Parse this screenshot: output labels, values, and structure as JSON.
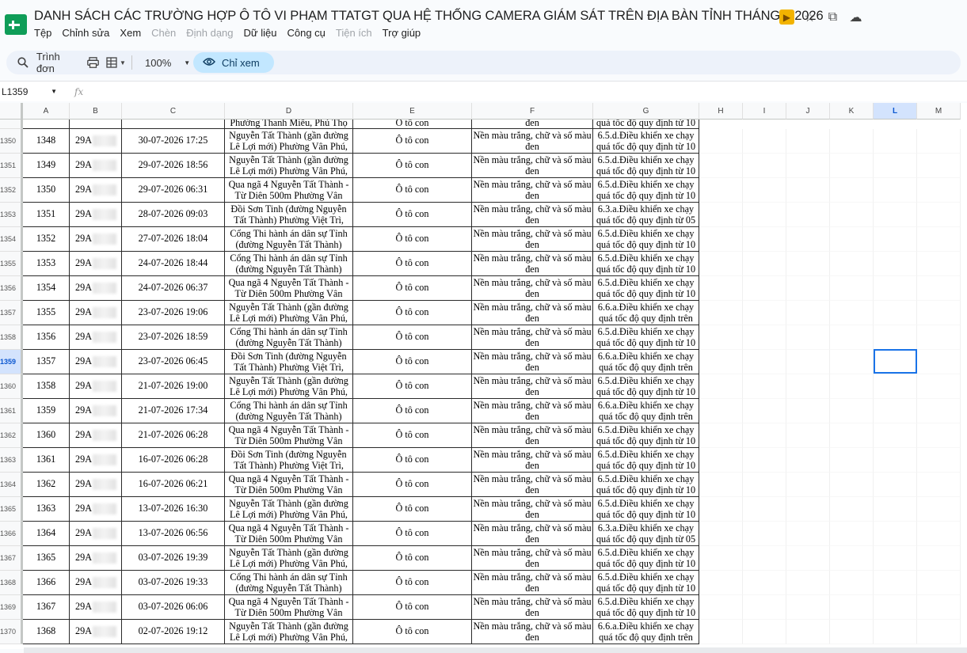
{
  "app": {
    "title": "DANH SÁCH CÁC TRƯỜNG HỢP Ô TÔ VI PHẠM TTATGT QUA HỆ THỐNG CAMERA GIÁM SÁT TRÊN ĐỊA BÀN TỈNH THÁNG 7.2026"
  },
  "menu": {
    "items": [
      {
        "label": "Tệp"
      },
      {
        "label": "Chỉnh sửa"
      },
      {
        "label": "Xem"
      },
      {
        "label": "Chèn"
      },
      {
        "label": "Định dạng"
      },
      {
        "label": "Dữ liệu"
      },
      {
        "label": "Công cụ"
      },
      {
        "label": "Tiện ích"
      },
      {
        "label": "Trợ giúp"
      }
    ]
  },
  "toolbar": {
    "search_label": "Trình đơn",
    "zoom": "100%",
    "view_only_label": "Chỉ xem"
  },
  "formula": {
    "name_box": "L1359",
    "fx": "fx"
  },
  "columns": [
    "A",
    "B",
    "C",
    "D",
    "E",
    "F",
    "G",
    "H",
    "I",
    "J",
    "K",
    "L",
    "M"
  ],
  "selected_column": "L",
  "selected_row": "1359",
  "rows": [
    {
      "n": "1350",
      "a": "1348",
      "b": "29A",
      "c": "30-07-2026 17:25",
      "d": "Nguyễn Tất Thành (gần đường Lê Lợi mới) Phường Vân Phú,",
      "e": "Ô tô con",
      "f": "Nền màu trắng, chữ và số màu đen",
      "g": "6.5.d.Điều khiển xe chạy quá tốc độ quy định từ 10"
    },
    {
      "n": "1351",
      "a": "1349",
      "b": "29A",
      "c": "29-07-2026 18:56",
      "d": "Nguyễn Tất Thành (gần đường Lê Lợi mới) Phường Vân Phú,",
      "e": "Ô tô con",
      "f": "Nền màu trắng, chữ và số màu đen",
      "g": "6.5.d.Điều khiển xe chạy quá tốc độ quy định từ 10"
    },
    {
      "n": "1352",
      "a": "1350",
      "b": "29A",
      "c": "29-07-2026 06:31",
      "d": "Qua ngã 4 Nguyễn Tất Thành - Từ Diên 500m Phường Vân",
      "e": "Ô tô con",
      "f": "Nền màu trắng, chữ và số màu đen",
      "g": "6.5.d.Điều khiển xe chạy quá tốc độ quy định từ 10"
    },
    {
      "n": "1353",
      "a": "1351",
      "b": "29A",
      "c": "28-07-2026 09:03",
      "d": "Đồi Sơn Tinh (đường Nguyễn Tất Thành) Phường Việt Trì,",
      "e": "Ô tô con",
      "f": "Nền màu trắng, chữ và số màu đen",
      "g": "6.3.a.Điều khiển xe chạy quá tốc độ quy định từ 05"
    },
    {
      "n": "1354",
      "a": "1352",
      "b": "29A",
      "c": "27-07-2026 18:04",
      "d": "Cổng Thi hành án dân sự Tỉnh (đường Nguyễn Tất Thành)",
      "e": "Ô tô con",
      "f": "Nền màu trắng, chữ và số màu đen",
      "g": "6.5.d.Điều khiển xe chạy quá tốc độ quy định từ 10"
    },
    {
      "n": "1355",
      "a": "1353",
      "b": "29A",
      "c": "24-07-2026 18:44",
      "d": "Cổng Thi hành án dân sự Tỉnh (đường Nguyễn Tất Thành)",
      "e": "Ô tô con",
      "f": "Nền màu trắng, chữ và số màu đen",
      "g": "6.5.d.Điều khiển xe chạy quá tốc độ quy định từ 10"
    },
    {
      "n": "1356",
      "a": "1354",
      "b": "29A",
      "c": "24-07-2026 06:37",
      "d": "Qua ngã 4 Nguyễn Tất Thành - Từ Diên 500m Phường Vân",
      "e": "Ô tô con",
      "f": "Nền màu trắng, chữ và số màu đen",
      "g": "6.5.d.Điều khiển xe chạy quá tốc độ quy định từ 10"
    },
    {
      "n": "1357",
      "a": "1355",
      "b": "29A",
      "c": "23-07-2026 19:06",
      "d": "Nguyễn Tất Thành (gần đường Lê Lợi mới) Phường Vân Phú,",
      "e": "Ô tô con",
      "f": "Nền màu trắng, chữ và số màu đen",
      "g": "6.6.a.Điều khiển xe chạy quá tốc độ quy định trên"
    },
    {
      "n": "1358",
      "a": "1356",
      "b": "29A",
      "c": "23-07-2026 18:59",
      "d": "Cổng Thi hành án dân sự Tỉnh (đường Nguyễn Tất Thành)",
      "e": "Ô tô con",
      "f": "Nền màu trắng, chữ và số màu đen",
      "g": "6.5.d.Điều khiển xe chạy quá tốc độ quy định từ 10"
    },
    {
      "n": "1359",
      "a": "1357",
      "b": "29A",
      "c": "23-07-2026 06:45",
      "d": "Đồi Sơn Tinh (đường Nguyễn Tất Thành) Phường Việt Trì,",
      "e": "Ô tô con",
      "f": "Nền màu trắng, chữ và số màu đen",
      "g": "6.6.a.Điều khiển xe chạy quá tốc độ quy định trên"
    },
    {
      "n": "1360",
      "a": "1358",
      "b": "29A",
      "c": "21-07-2026 19:00",
      "d": "Nguyễn Tất Thành (gần đường Lê Lợi mới) Phường Vân Phú,",
      "e": "Ô tô con",
      "f": "Nền màu trắng, chữ và số màu đen",
      "g": "6.5.d.Điều khiển xe chạy quá tốc độ quy định từ 10"
    },
    {
      "n": "1361",
      "a": "1359",
      "b": "29A",
      "c": "21-07-2026 17:34",
      "d": "Cổng Thi hành án dân sự Tỉnh (đường Nguyễn Tất Thành)",
      "e": "Ô tô con",
      "f": "Nền màu trắng, chữ và số màu đen",
      "g": "6.6.a.Điều khiển xe chạy quá tốc độ quy định trên"
    },
    {
      "n": "1362",
      "a": "1360",
      "b": "29A",
      "c": "21-07-2026 06:28",
      "d": "Qua ngã 4 Nguyễn Tất Thành - Từ Diên 500m Phường Vân",
      "e": "Ô tô con",
      "f": "Nền màu trắng, chữ và số màu đen",
      "g": "6.5.d.Điều khiển xe chạy quá tốc độ quy định từ 10"
    },
    {
      "n": "1363",
      "a": "1361",
      "b": "29A",
      "c": "16-07-2026 06:28",
      "d": "Đồi Sơn Tinh (đường Nguyễn Tất Thành) Phường Việt Trì,",
      "e": "Ô tô con",
      "f": "Nền màu trắng, chữ và số màu đen",
      "g": "6.5.d.Điều khiển xe chạy quá tốc độ quy định từ 10"
    },
    {
      "n": "1364",
      "a": "1362",
      "b": "29A",
      "c": "16-07-2026 06:21",
      "d": "Qua ngã 4 Nguyễn Tất Thành - Từ Diên 500m Phường Vân",
      "e": "Ô tô con",
      "f": "Nền màu trắng, chữ và số màu đen",
      "g": "6.5.d.Điều khiển xe chạy quá tốc độ quy định từ 10"
    },
    {
      "n": "1365",
      "a": "1363",
      "b": "29A",
      "c": "13-07-2026 16:30",
      "d": "Nguyễn Tất Thành (gần đường Lê Lợi mới) Phường Vân Phú,",
      "e": "Ô tô con",
      "f": "Nền màu trắng, chữ và số màu đen",
      "g": "6.5.d.Điều khiển xe chạy quá tốc độ quy định từ 10"
    },
    {
      "n": "1366",
      "a": "1364",
      "b": "29A",
      "c": "13-07-2026 06:56",
      "d": "Qua ngã 4 Nguyễn Tất Thành - Từ Diên 500m Phường Vân",
      "e": "Ô tô con",
      "f": "Nền màu trắng, chữ và số màu đen",
      "g": "6.3.a.Điều khiển xe chạy quá tốc độ quy định từ 05"
    },
    {
      "n": "1367",
      "a": "1365",
      "b": "29A",
      "c": "03-07-2026 19:39",
      "d": "Nguyễn Tất Thành (gần đường Lê Lợi mới) Phường Vân Phú,",
      "e": "Ô tô con",
      "f": "Nền màu trắng, chữ và số màu đen",
      "g": "6.5.d.Điều khiển xe chạy quá tốc độ quy định từ 10"
    },
    {
      "n": "1368",
      "a": "1366",
      "b": "29A",
      "c": "03-07-2026 19:33",
      "d": "Cổng Thi hành án dân sự Tỉnh (đường Nguyễn Tất Thành)",
      "e": "Ô tô con",
      "f": "Nền màu trắng, chữ và số màu đen",
      "g": "6.5.d.Điều khiển xe chạy quá tốc độ quy định từ 10"
    },
    {
      "n": "1369",
      "a": "1367",
      "b": "29A",
      "c": "03-07-2026 06:06",
      "d": "Qua ngã 4 Nguyễn Tất Thành - Từ Diên 500m Phường Vân",
      "e": "Ô tô con",
      "f": "Nền màu trắng, chữ và số màu đen",
      "g": "6.5.d.Điều khiển xe chạy quá tốc độ quy định từ 10"
    },
    {
      "n": "1370",
      "a": "1368",
      "b": "29A",
      "c": "02-07-2026 19:12",
      "d": "Nguyễn Tất Thành (gần đường Lê Lợi mới) Phường Vân Phú,",
      "e": "Ô tô con",
      "f": "Nền màu trắng, chữ và số màu đen",
      "g": "6.6.a.Điều khiển xe chạy quá tốc độ quy định trên"
    }
  ],
  "partial_top_row": {
    "d": "Phường Thanh Miếu, Phú Thọ",
    "e": "Ô tô con",
    "f": "đen",
    "g": "quá tốc độ quy định từ 10"
  },
  "icons": {
    "app": "sheets-logo-icon",
    "badge": "slides-badge-icon",
    "star": "star-icon",
    "move": "move-to-drive-icon",
    "cloud": "cloud-status-icon",
    "search": "search-icon",
    "print": "print-icon",
    "format": "paint-format-icon",
    "view": "eye-icon"
  },
  "colors": {
    "accent": "#1a73e8",
    "chip": "#c2e7ff",
    "toolbar_bg": "#edf2fa",
    "logo": "#0f9d58"
  }
}
